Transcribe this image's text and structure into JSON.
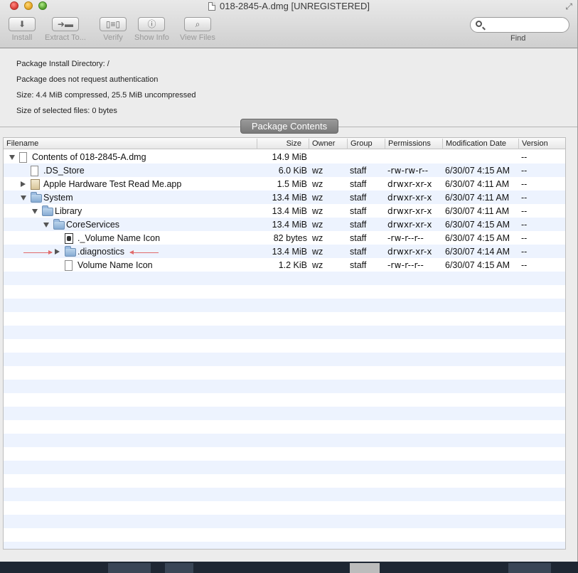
{
  "window": {
    "title": "018-2845-A.dmg [UNREGISTERED]"
  },
  "toolbar": {
    "buttons": [
      {
        "label": "Install",
        "icon": "download-arrow-icon"
      },
      {
        "label": "Extract To...",
        "icon": "extract-folder-icon"
      },
      {
        "label": "Verify",
        "icon": "verify-icon"
      },
      {
        "label": "Show Info",
        "icon": "info-icon"
      },
      {
        "label": "View Files",
        "icon": "magnifier-icon"
      }
    ],
    "search": {
      "placeholder": "",
      "label": "Find"
    }
  },
  "info": {
    "install_dir": "Package Install Directory: /",
    "auth": "Package does not request authentication",
    "size": "Size: 4.4 MiB compressed, 25.5 MiB uncompressed",
    "selected": "Size of selected files: 0 bytes"
  },
  "package_contents_label": "Package Contents",
  "table": {
    "columns": [
      "Filename",
      "Size",
      "Owner",
      "Group",
      "Permissions",
      "Modification Date",
      "Version"
    ],
    "rows": [
      {
        "name": "Contents of 018-2845-A.dmg",
        "size": "14.9 MiB",
        "owner": "",
        "group": "",
        "perm": "",
        "date": "",
        "version": "--",
        "depth": 0,
        "disclosure": "open",
        "icon": "document"
      },
      {
        "name": ".DS_Store",
        "size": "6.0 KiB",
        "owner": "wz",
        "group": "staff",
        "perm": "-rw-rw-r--",
        "date": "6/30/07 4:15 AM",
        "version": "--",
        "depth": 1,
        "disclosure": "none",
        "icon": "document"
      },
      {
        "name": "Apple Hardware Test Read Me.app",
        "size": "1.5 MiB",
        "owner": "wz",
        "group": "staff",
        "perm": "drwxr-xr-x",
        "date": "6/30/07 4:11 AM",
        "version": "--",
        "depth": 1,
        "disclosure": "closed",
        "icon": "app"
      },
      {
        "name": "System",
        "size": "13.4 MiB",
        "owner": "wz",
        "group": "staff",
        "perm": "drwxr-xr-x",
        "date": "6/30/07 4:11 AM",
        "version": "--",
        "depth": 1,
        "disclosure": "open",
        "icon": "folder"
      },
      {
        "name": "Library",
        "size": "13.4 MiB",
        "owner": "wz",
        "group": "staff",
        "perm": "drwxr-xr-x",
        "date": "6/30/07 4:11 AM",
        "version": "--",
        "depth": 2,
        "disclosure": "open",
        "icon": "folder"
      },
      {
        "name": "CoreServices",
        "size": "13.4 MiB",
        "owner": "wz",
        "group": "staff",
        "perm": "drwxr-xr-x",
        "date": "6/30/07 4:15 AM",
        "version": "--",
        "depth": 3,
        "disclosure": "open",
        "icon": "folder"
      },
      {
        "name": "._Volume Name Icon",
        "size": "82 bytes",
        "owner": "wz",
        "group": "staff",
        "perm": "-rw-r--r--",
        "date": "6/30/07 4:15 AM",
        "version": "--",
        "depth": 4,
        "disclosure": "none",
        "icon": "dark"
      },
      {
        "name": ".diagnostics",
        "size": "13.4 MiB",
        "owner": "wz",
        "group": "staff",
        "perm": "drwxr-xr-x",
        "date": "6/30/07 4:14 AM",
        "version": "--",
        "depth": 4,
        "disclosure": "closed",
        "icon": "folder"
      },
      {
        "name": "Volume Name Icon",
        "size": "1.2 KiB",
        "owner": "wz",
        "group": "staff",
        "perm": "-rw-r--r--",
        "date": "6/30/07 4:15 AM",
        "version": "--",
        "depth": 4,
        "disclosure": "none",
        "icon": "document"
      }
    ]
  }
}
